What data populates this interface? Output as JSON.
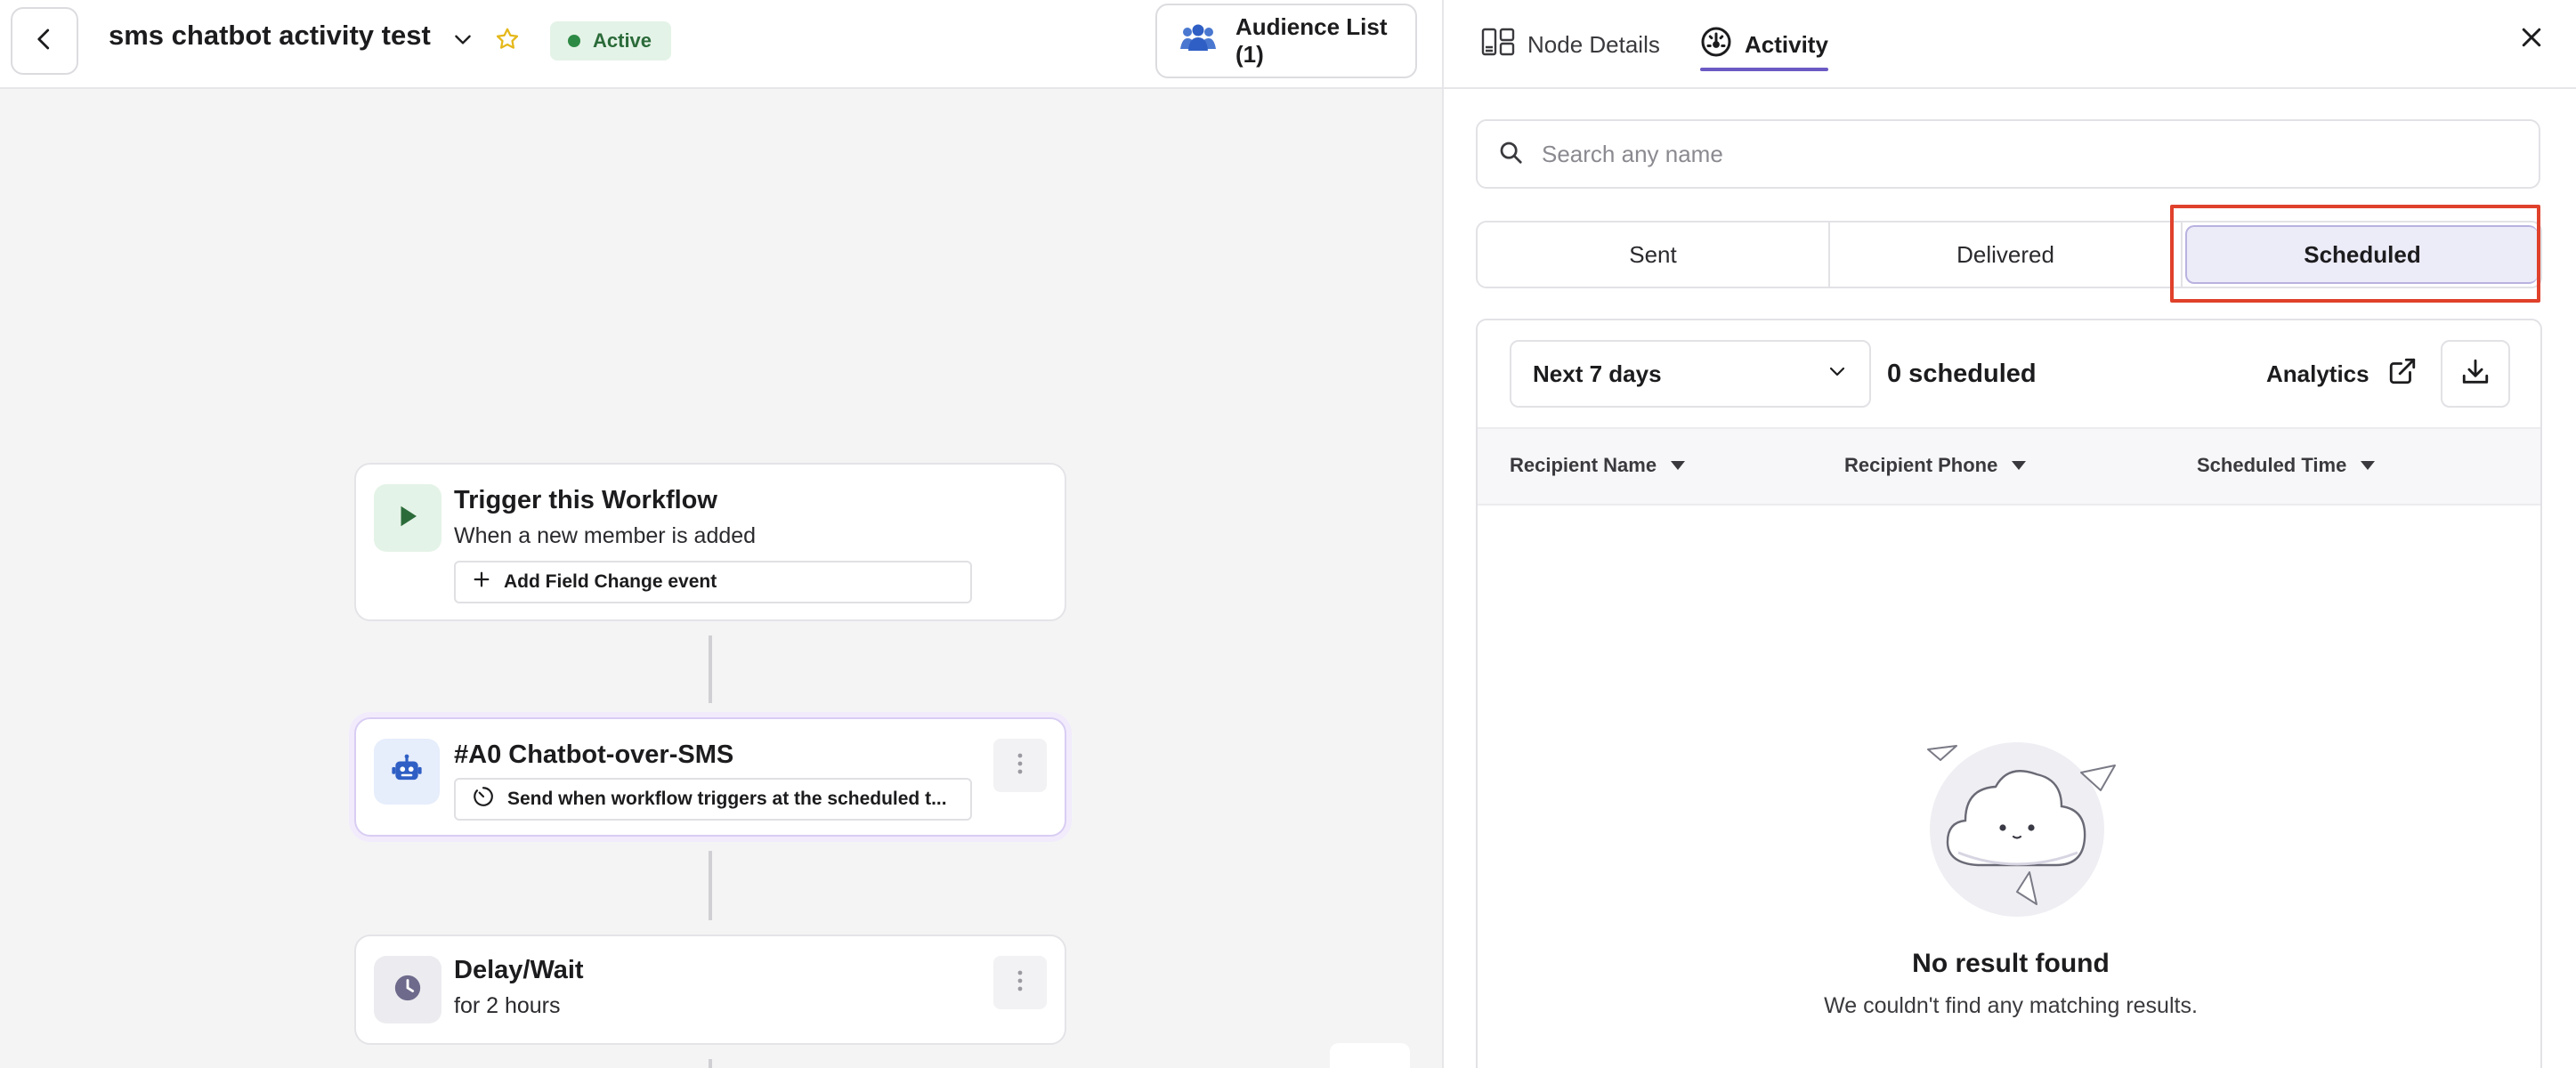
{
  "header": {
    "workflow_title": "sms chatbot activity test",
    "status": "Active",
    "audience_button": "Audience List (1)"
  },
  "canvas": {
    "nodes": [
      {
        "title": "Trigger this Workflow",
        "subtitle": "When a new member is added",
        "chip": "Add Field Change event",
        "icon": "play-icon"
      },
      {
        "title": "#A0 Chatbot-over-SMS",
        "chip": "Send when workflow triggers at the scheduled t...",
        "icon": "robot-icon"
      },
      {
        "title": "Delay/Wait",
        "subtitle": "for 2 hours",
        "icon": "clock-icon"
      }
    ]
  },
  "panel": {
    "tabs": [
      {
        "label": "Node Details",
        "icon": "node-details-icon"
      },
      {
        "label": "Activity",
        "icon": "gauge-icon",
        "active": true
      }
    ],
    "search": {
      "placeholder": "Search any name",
      "value": ""
    },
    "segments": [
      {
        "label": "Sent"
      },
      {
        "label": "Delivered"
      },
      {
        "label": "Scheduled",
        "active": true
      }
    ],
    "range_select": "Next 7 days",
    "scheduled_count": "0 scheduled",
    "analytics_label": "Analytics",
    "columns": [
      "Recipient Name",
      "Recipient Phone",
      "Scheduled Time"
    ],
    "empty_title": "No result found",
    "empty_subtitle": "We couldn't find any matching results."
  },
  "colors": {
    "accent": "#6c5ac4",
    "active_green": "#2d8a45",
    "highlight_red": "#e0412b",
    "star_yellow": "#e5b81a"
  }
}
